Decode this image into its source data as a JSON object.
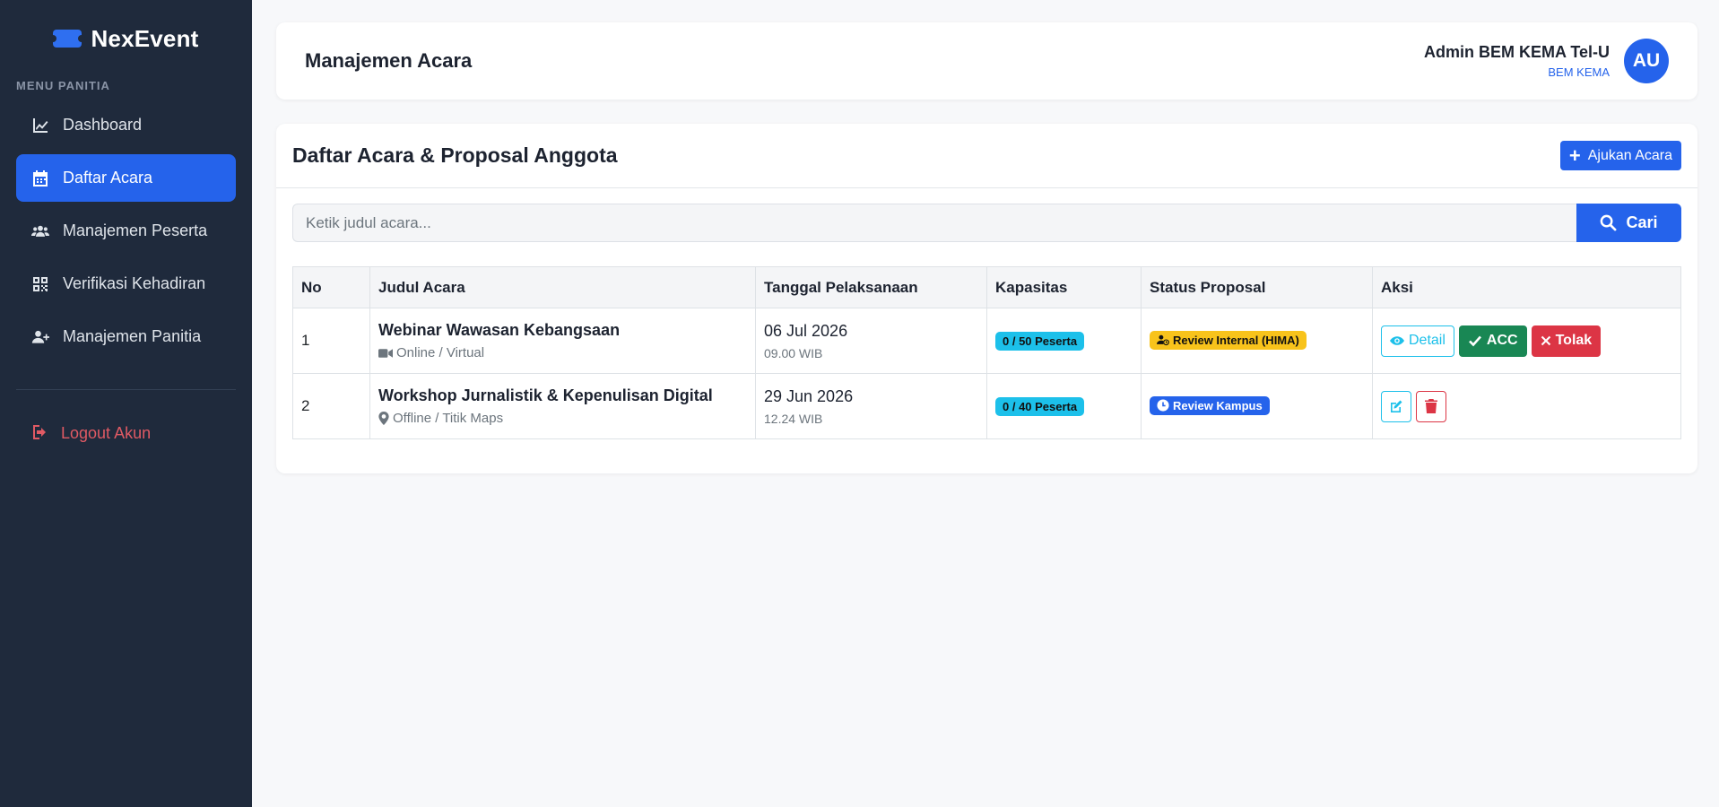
{
  "brand": {
    "name": "NexEvent",
    "icon": "ticket-icon",
    "color": "#2563eb"
  },
  "sidebar": {
    "menu_label": "MENU PANITIA",
    "items": [
      {
        "label": "Dashboard",
        "icon": "chart-line-icon",
        "active": false
      },
      {
        "label": "Daftar Acara",
        "icon": "calendar-icon",
        "active": true
      },
      {
        "label": "Manajemen Peserta",
        "icon": "users-icon",
        "active": false
      },
      {
        "label": "Verifikasi Kehadiran",
        "icon": "qrcode-icon",
        "active": false
      },
      {
        "label": "Manajemen Panitia",
        "icon": "user-plus-icon",
        "active": false
      }
    ],
    "logout_label": "Logout Akun"
  },
  "header": {
    "title": "Manajemen Acara",
    "user_name": "Admin BEM KEMA Tel-U",
    "user_role": "BEM KEMA",
    "avatar_initials": "AU"
  },
  "main": {
    "title": "Daftar Acara & Proposal Anggota",
    "add_button": "Ajukan Acara",
    "search": {
      "placeholder": "Ketik judul acara...",
      "value": "",
      "button": "Cari"
    },
    "table": {
      "headers": [
        "No",
        "Judul Acara",
        "Tanggal Pelaksanaan",
        "Kapasitas",
        "Status Proposal",
        "Aksi"
      ],
      "rows": [
        {
          "no": "1",
          "title": "Webinar Wawasan Kebangsaan",
          "mode": "Online / Virtual",
          "mode_icon": "video-icon",
          "date": "06 Jul 2026",
          "time": "09.00 WIB",
          "capacity": "0 / 50 Peserta",
          "status": "Review Internal (HIMA)",
          "status_icon": "user-clock-icon",
          "actions": {
            "detail": "Detail",
            "acc": "ACC",
            "reject": "Tolak"
          }
        },
        {
          "no": "2",
          "title": "Workshop Jurnalistik & Kepenulisan Digital",
          "mode": "Offline / Titik Maps",
          "mode_icon": "map-marker-icon",
          "date": "29 Jun 2026",
          "time": "12.24 WIB",
          "capacity": "0 / 40 Peserta",
          "status": "Review Kampus",
          "status_icon": "clock-icon"
        }
      ]
    }
  },
  "colors": {
    "sidebar_bg": "#1f2a3c",
    "accent": "#2563eb",
    "logout": "#e05a64",
    "info": "#1cc0ea",
    "warning": "#f8c31b",
    "success": "#198754",
    "danger": "#dc3545"
  }
}
